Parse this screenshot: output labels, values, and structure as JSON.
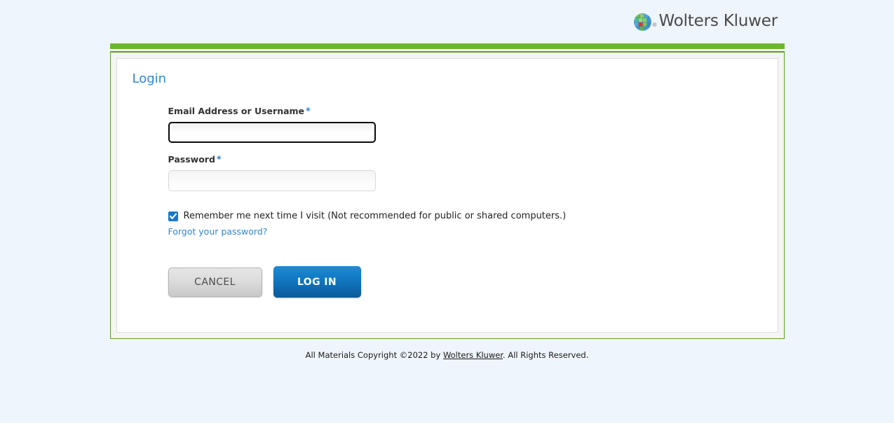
{
  "brand": {
    "name": "Wolters Kluwer",
    "registered_mark": "®",
    "logo_icon": "wolters-kluwer-globe-icon",
    "colors": {
      "accent_blue": "#2e86d4",
      "brand_green": "#6cb82a",
      "logo_red": "#e8342a",
      "page_background": "#eff5fc"
    }
  },
  "login": {
    "title": "Login",
    "fields": {
      "email": {
        "label": "Email Address or Username",
        "required_marker": "*",
        "value": "",
        "placeholder": "",
        "focused": true
      },
      "password": {
        "label": "Password",
        "required_marker": "*",
        "value": "",
        "placeholder": "",
        "focused": false
      }
    },
    "remember": {
      "checked": true,
      "label": "Remember me next time I visit (Not recommended for public or shared computers.)"
    },
    "forgot_password_link": "Forgot your password?",
    "buttons": {
      "cancel": "CANCEL",
      "submit": "LOG IN"
    }
  },
  "footer": {
    "text_before_link": "All Materials Copyright ©2022 by ",
    "link_text": "Wolters Kluwer",
    "text_after_link": ". All Rights Reserved."
  }
}
